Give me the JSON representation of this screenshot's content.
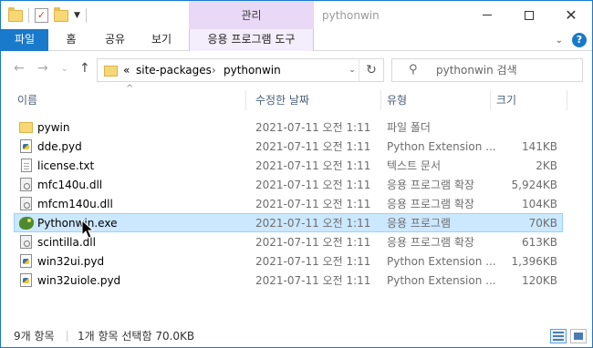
{
  "titlebar": {
    "context_tab_top": "관리",
    "window_title": "pythonwin"
  },
  "ribbon": {
    "tabs": [
      "파일",
      "홈",
      "공유",
      "보기"
    ],
    "context_tab": "응용 프로그램 도구"
  },
  "address": {
    "overflow": "«",
    "crumbs": [
      "site-packages",
      "pythonwin"
    ],
    "separator": "›"
  },
  "search": {
    "placeholder": "pythonwin 검색"
  },
  "columns": {
    "name": "이름",
    "date": "수정한 날짜",
    "type": "유형",
    "size": "크기"
  },
  "files": [
    {
      "name": "pywin",
      "date": "2021-07-11 오전 1:11",
      "type": "파일 폴더",
      "size": "",
      "icon": "folder-icon"
    },
    {
      "name": "dde.pyd",
      "date": "2021-07-11 오전 1:11",
      "type": "Python Extension ...",
      "size": "141KB",
      "icon": "pyd-icon"
    },
    {
      "name": "license.txt",
      "date": "2021-07-11 오전 1:11",
      "type": "텍스트 문서",
      "size": "2KB",
      "icon": "text-file-icon"
    },
    {
      "name": "mfc140u.dll",
      "date": "2021-07-11 오전 1:11",
      "type": "응용 프로그램 확장",
      "size": "5,924KB",
      "icon": "dll-icon"
    },
    {
      "name": "mfcm140u.dll",
      "date": "2021-07-11 오전 1:11",
      "type": "응용 프로그램 확장",
      "size": "104KB",
      "icon": "dll-icon"
    },
    {
      "name": "Pythonwin.exe",
      "date": "2021-07-11 오전 1:11",
      "type": "응용 프로그램",
      "size": "70KB",
      "icon": "exe-icon",
      "selected": true
    },
    {
      "name": "scintilla.dll",
      "date": "2021-07-11 오전 1:11",
      "type": "응용 프로그램 확장",
      "size": "613KB",
      "icon": "dll-icon"
    },
    {
      "name": "win32ui.pyd",
      "date": "2021-07-11 오전 1:11",
      "type": "Python Extension ...",
      "size": "1,396KB",
      "icon": "pyd-icon"
    },
    {
      "name": "win32uiole.pyd",
      "date": "2021-07-11 오전 1:11",
      "type": "Python Extension ...",
      "size": "120KB",
      "icon": "pyd-icon"
    }
  ],
  "status": {
    "item_count": "9개 항목",
    "selection": "1개 항목 선택함 70.0KB"
  },
  "colors": {
    "accent": "#1979ca",
    "context_tab": "#e9d8f6",
    "selection": "#cce8ff"
  }
}
